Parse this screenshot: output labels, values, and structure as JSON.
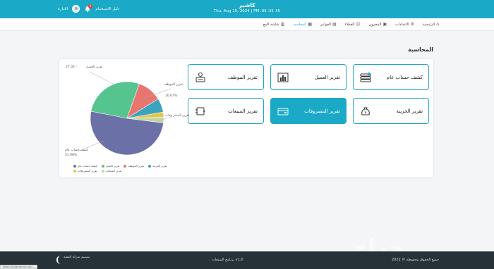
{
  "header": {
    "title": "كاشير",
    "clock": "Thu, Aug 15, 2024  |  PM :05 :51 35",
    "user_name": "الادارة",
    "user_guide": "دليل الاستخدام",
    "notification_count": "0",
    "accent": "#1aa9c6"
  },
  "nav": {
    "items": [
      {
        "label": "الرئيسية",
        "icon": "home-icon"
      },
      {
        "label": "الاعدادات",
        "icon": "settings-icon"
      },
      {
        "label": "المخزون",
        "icon": "inventory-icon"
      },
      {
        "label": "العملاء",
        "icon": "customers-icon"
      },
      {
        "label": "الفواتير",
        "icon": "invoices-icon"
      },
      {
        "label": "المحاسبة",
        "icon": "accounting-icon"
      },
      {
        "label": "شاشة البيع",
        "icon": "pos-icon"
      }
    ],
    "active_index": 5
  },
  "page": {
    "title": "المحاسبة"
  },
  "tiles": [
    {
      "label": "كشف حساب عام",
      "icon": "ledger-icon"
    },
    {
      "label": "تقرير العميل",
      "icon": "bar-chart-icon"
    },
    {
      "label": "تقرير الموظف",
      "icon": "employee-icon"
    },
    {
      "label": "تقرير الخزينة",
      "icon": "money-bag-icon"
    },
    {
      "label": "تقرير المصروفات",
      "icon": "expenses-icon"
    },
    {
      "label": "تقرير المبيعات",
      "icon": "sales-icon"
    }
  ],
  "chart_data": {
    "type": "pie",
    "slices": [
      {
        "label": "كشف حساب عام",
        "value": 51.08,
        "color": "#6b71a6"
      },
      {
        "label": "تقرير العميل",
        "value": 27.34,
        "color": "#56c48f"
      },
      {
        "label": "تقرير الموظف",
        "value": 10.67,
        "color": "#e8766e"
      },
      {
        "label": "تقرير الخزينة",
        "value": 6.2,
        "color": "#3ca3bf"
      },
      {
        "label": "تقرير المصروفات",
        "value": 2.2,
        "color": "#e6c547"
      },
      {
        "label": "تقرير المبيعات",
        "value": 2.51,
        "color": "#c2d7a0"
      }
    ],
    "annotations": {
      "main": "كشف حساب عام",
      "main_value": "51.08%",
      "top": "تقرير العميل",
      "top_value": "27.34 -",
      "right": "تقرير الموظف",
      "right_value": "10.67%",
      "right2": "تقرير المصر وفات"
    },
    "legend": [
      {
        "label": "كشف حساب عام",
        "color": "#6b71a6"
      },
      {
        "label": "تقرير العميل",
        "color": "#56c48f"
      },
      {
        "label": "تقرير الموظف",
        "color": "#e8766e"
      },
      {
        "label": "تقرير الخزينة",
        "color": "#3ca3bf"
      },
      {
        "label": "تقرير المصروفات",
        "color": "#e6c547"
      },
      {
        "label": "تقرير المبيعات",
        "color": "#c2d7a0"
      }
    ]
  },
  "footer": {
    "copyright": "2022 © جميع الحقوق محفوظة",
    "version": "برنامج المبيعات v1.0",
    "brand": "تصميم شركة التقنية",
    "url": "https://codecanyon.net/..."
  },
  "watermark": "حراج"
}
